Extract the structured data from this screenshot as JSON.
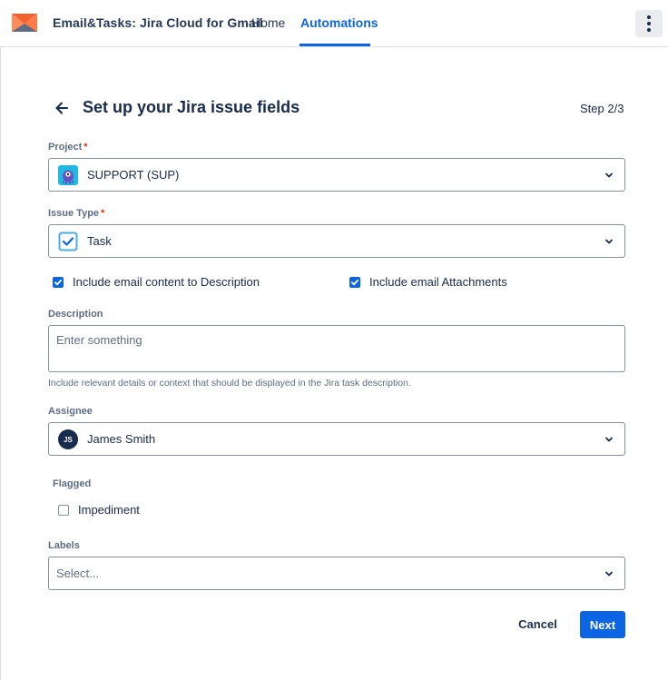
{
  "header": {
    "app_title": "Email&Tasks: Jira Cloud for Gmail",
    "tabs": [
      {
        "label": "Home",
        "active": false
      },
      {
        "label": "Automations",
        "active": true
      }
    ],
    "menu_icon": "kebab-menu-icon",
    "logo_icon": "mail-envelope-logo"
  },
  "page": {
    "title": "Set up your Jira issue fields",
    "step": "Step 2/3"
  },
  "form": {
    "project": {
      "label": "Project",
      "required": "*",
      "value": "SUPPORT (SUP)",
      "icon": "project-avatar-icon"
    },
    "issue_type": {
      "label": "Issue Type",
      "required": "*",
      "value": "Task",
      "icon": "task-checkbox-icon"
    },
    "include_description": {
      "label": "Include email content to Description",
      "checked": true
    },
    "include_attachments": {
      "label": "Include email Attachments",
      "checked": true
    },
    "description": {
      "label": "Description",
      "placeholder": "Enter something",
      "helper": "Include relevant details or context that should be displayed in the Jira task description."
    },
    "assignee": {
      "label": "Assignee",
      "value": "James Smith",
      "initials": "JS"
    },
    "flagged": {
      "label": "Flagged",
      "option": "Impediment",
      "checked": false
    },
    "labels": {
      "label": "Labels",
      "placeholder": "Select..."
    }
  },
  "actions": {
    "cancel": "Cancel",
    "next": "Next"
  },
  "colors": {
    "accent": "#0c66e4",
    "text": "#172b4d",
    "required": "#de350b",
    "border": "#8590a2"
  }
}
